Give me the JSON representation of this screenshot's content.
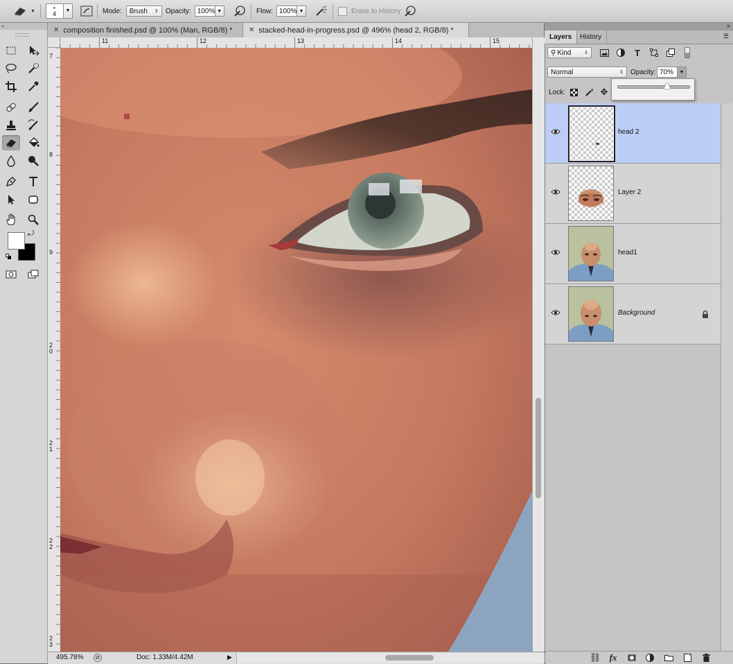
{
  "options_bar": {
    "brush_size": "4",
    "mode_label": "Mode:",
    "mode_value": "Brush",
    "opacity_label": "Opacity:",
    "opacity_value": "100%",
    "flow_label": "Flow:",
    "flow_value": "100%",
    "erase_history_label": "Erase to History"
  },
  "tabs": [
    {
      "label": "composition finished.psd @ 100% (Man, RGB/8) *"
    },
    {
      "label": "stacked-head-in-progress.psd @ 496% (head 2, RGB/8) *"
    }
  ],
  "ruler": {
    "h_ticks": [
      "11",
      "12",
      "13",
      "14",
      "15"
    ],
    "v_ticks": [
      "7",
      "8",
      "9",
      "20",
      "21",
      "22",
      "23"
    ]
  },
  "status": {
    "zoom": "495.78%",
    "doc": "Doc: 1.33M/4.42M"
  },
  "layers_panel": {
    "tabs": [
      "Layers",
      "History"
    ],
    "filter_kind": "Kind",
    "blend_mode": "Normal",
    "opacity_label": "Opacity:",
    "opacity_value": "70%",
    "opacity_slider": 0.7,
    "lock_label": "Lock:",
    "layers": [
      {
        "name": "head 2",
        "selected": true,
        "visible": true,
        "locked": false
      },
      {
        "name": "Layer 2",
        "selected": false,
        "visible": true,
        "locked": false
      },
      {
        "name": "head1",
        "selected": false,
        "visible": true,
        "locked": false
      },
      {
        "name": "Background",
        "selected": false,
        "visible": true,
        "locked": true
      }
    ]
  },
  "colors": {
    "foreground": "#ffffff",
    "background": "#000000",
    "selection": "#bccdf6"
  }
}
